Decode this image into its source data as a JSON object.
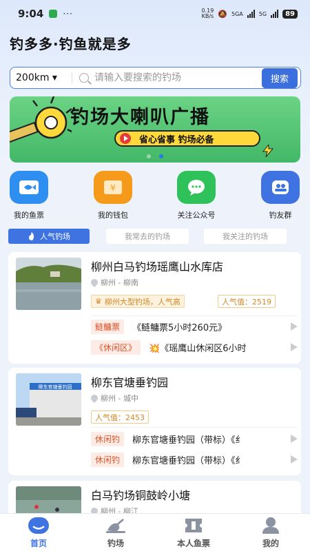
{
  "status_bar": {
    "time": "9:04",
    "dots": "···",
    "speed_top": "0.19",
    "speed_bottom": "KB/s",
    "net1": "5GA",
    "net2": "5G",
    "battery": "89"
  },
  "header": {
    "title": "钓多多·钓鱼就是多"
  },
  "search": {
    "distance": "200km ▾",
    "placeholder": "请输入要搜索的钓场",
    "button": "搜索"
  },
  "banner": {
    "headline": "钓场大喇叭广播",
    "slogan": "省心省事 钓场必备",
    "slide_count": 2,
    "active_slide": 2
  },
  "quick_menu": [
    {
      "label": "我的鱼票",
      "icon": "fish-ticket-icon",
      "color": "#2f8ff0"
    },
    {
      "label": "我的钱包",
      "icon": "wallet-icon",
      "color": "#f59a1b"
    },
    {
      "label": "关注公众号",
      "icon": "wechat-icon",
      "color": "#2fc25b"
    },
    {
      "label": "钓友群",
      "icon": "group-icon",
      "color": "#3f73e2"
    }
  ],
  "tabs": [
    {
      "label": "人气钓场",
      "active": true
    },
    {
      "label": "我常去的钓场",
      "active": false
    },
    {
      "label": "我关注的钓场",
      "active": false
    }
  ],
  "cards": [
    {
      "name": "柳州白马钓场瑶鹰山水库店",
      "location": "柳州 - 柳南",
      "badge": "柳州大型钓场，人气高",
      "popularity": "人气值：2519",
      "rows": [
        {
          "tag": "鲢鳙票",
          "text": "《鲢鳙票5小时260元》"
        },
        {
          "tag": "《休闲区》",
          "text": "💥《瑶鹰山休闲区6小时"
        }
      ]
    },
    {
      "name": "柳东官塘垂钓园",
      "location": "柳州 - 城中",
      "badge": "",
      "popularity": "人气值：2453",
      "thumb_sign": "柳东官塘垂钓园",
      "rows": [
        {
          "tag": "休闲钓",
          "text": "柳东官塘垂钓园（带标）《纟"
        },
        {
          "tag": "休闲钓",
          "text": "柳东官塘垂钓园（带标）《纟"
        }
      ]
    },
    {
      "name": "白马钓场铜鼓岭小塘",
      "location": "柳州 - 柳江"
    }
  ],
  "bottom_nav": [
    {
      "label": "首页",
      "icon": "home-icon",
      "active": true
    },
    {
      "label": "钓场",
      "icon": "fishing-spot-icon",
      "active": false
    },
    {
      "label": "本人鱼票",
      "icon": "ticket-icon",
      "active": false
    },
    {
      "label": "我的",
      "icon": "profile-icon",
      "active": false
    }
  ],
  "colors": {
    "accent": "#3f73e2",
    "tag_red": "#e3532c",
    "gold": "#d0892a",
    "banner_green": "#4cbf6e",
    "banner_yellow": "#ffd93b"
  }
}
